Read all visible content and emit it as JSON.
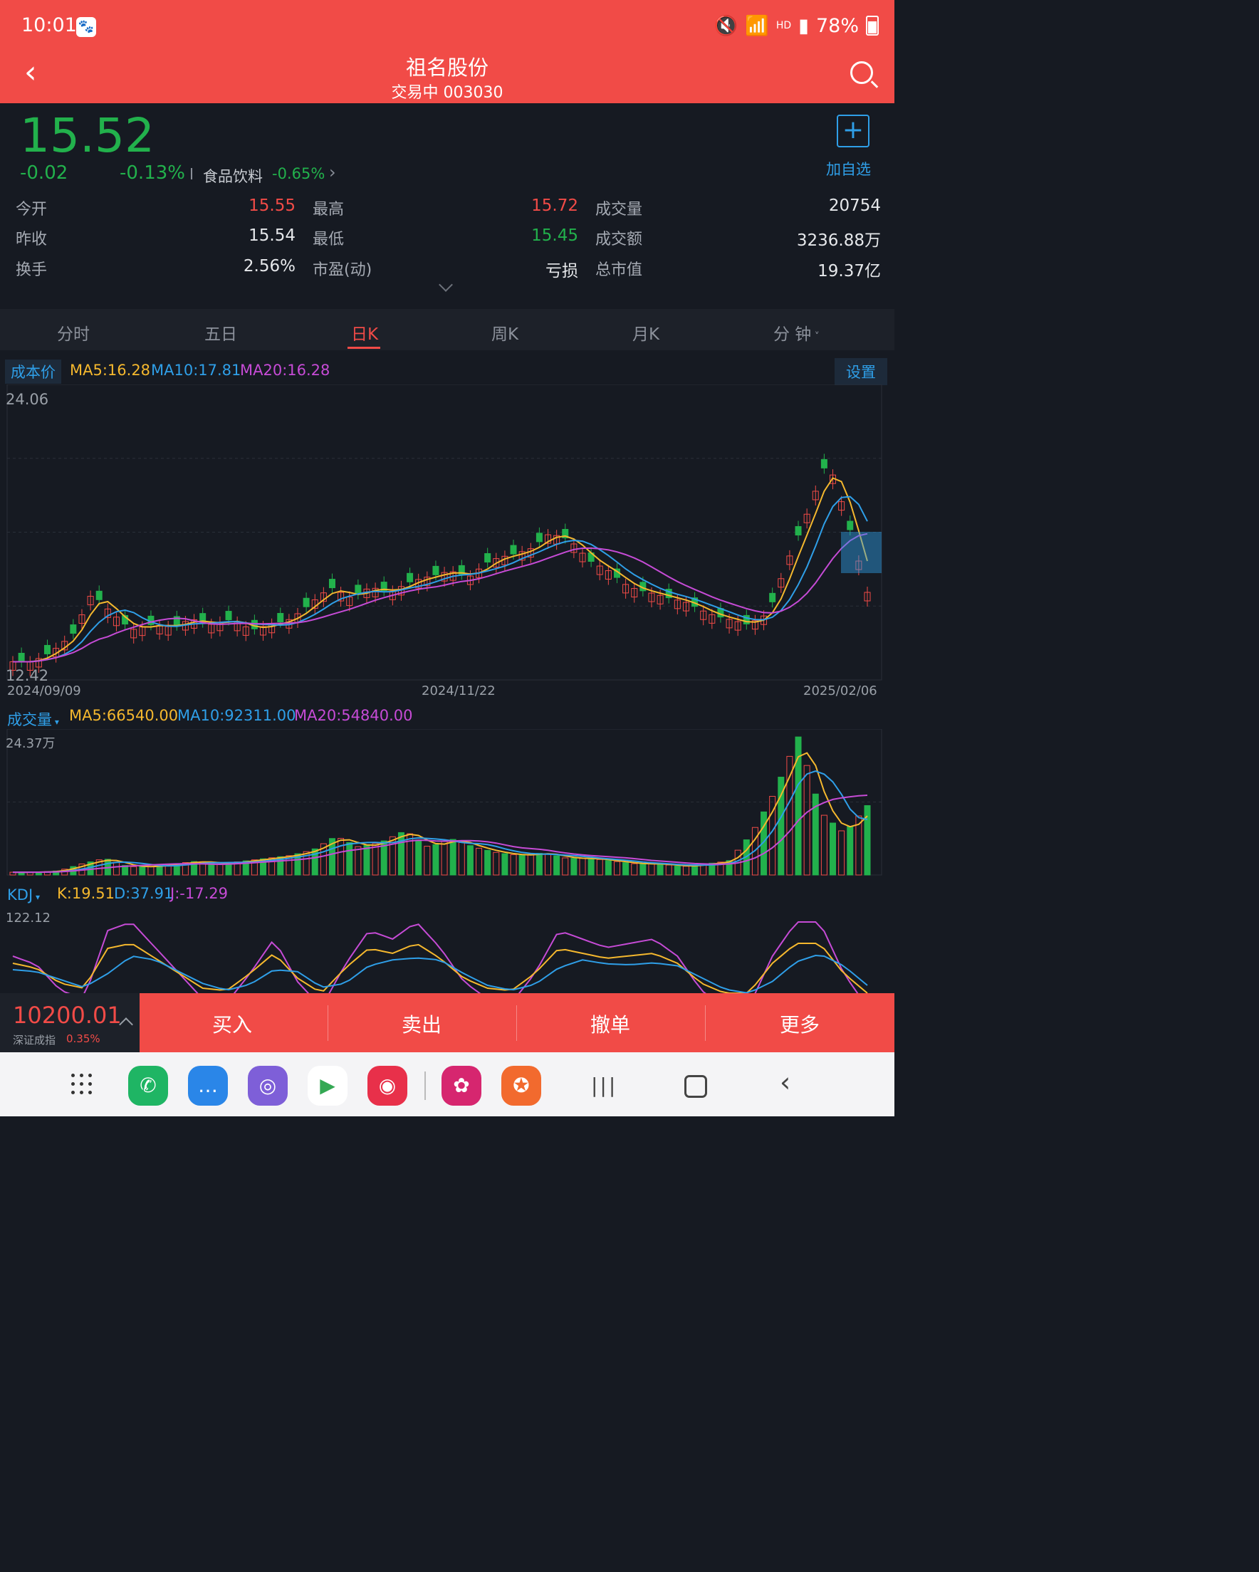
{
  "status_bar": {
    "time": "10:01",
    "network": "HD",
    "battery": "78%"
  },
  "header": {
    "title": "祖名股份",
    "subtitle": "交易中 003030"
  },
  "quote": {
    "price": "15.52",
    "change": "-0.02",
    "change_pct": "-0.13%",
    "sector_name": "食品饮料",
    "sector_change": "-0.65%",
    "watchlist_label": "加自选",
    "stats": [
      {
        "label": "今开",
        "value": "15.55",
        "color": "#f14b47"
      },
      {
        "label": "最高",
        "value": "15.72",
        "color": "#f14b47"
      },
      {
        "label": "成交量",
        "value": "20754",
        "color": "#e6e8eb"
      },
      {
        "label": "昨收",
        "value": "15.54",
        "color": "#e6e8eb"
      },
      {
        "label": "最低",
        "value": "15.45",
        "color": "#22b14c"
      },
      {
        "label": "成交额",
        "value": "3236.88万",
        "color": "#e6e8eb"
      },
      {
        "label": "换手",
        "value": "2.56%",
        "color": "#e6e8eb"
      },
      {
        "label": "市盈(动)",
        "value": "亏损",
        "color": "#e6e8eb"
      },
      {
        "label": "总市值",
        "value": "19.37亿",
        "color": "#e6e8eb"
      }
    ]
  },
  "tabs": [
    "分时",
    "五日",
    "日K",
    "周K",
    "月K",
    "分 钟"
  ],
  "active_tab": "日K",
  "kline": {
    "cost_label": "成本价",
    "ma5": "MA5:16.28",
    "ma10": "MA10:17.81",
    "ma20": "MA20:16.28",
    "settings_label": "设置",
    "y_max": "24.06",
    "y_min": "12.42",
    "dates": [
      "2024/09/09",
      "2024/11/22",
      "2025/02/06"
    ]
  },
  "volume": {
    "label": "成交量",
    "ma5": "MA5:66540.00",
    "ma10": "MA10:92311.00",
    "ma20": "MA20:54840.00",
    "y_max": "24.37万"
  },
  "kdj": {
    "label": "KDJ",
    "k": "K:19.51",
    "d": "D:37.91",
    "j": "J:-17.29",
    "y_max": "122.12"
  },
  "trade_bar": {
    "index_value": "10200.01",
    "index_name": "深证成指",
    "index_change": "0.35%",
    "buttons": [
      "买入",
      "卖出",
      "撤单",
      "更多"
    ]
  },
  "colors": {
    "up": "#f14b47",
    "down": "#22b14c",
    "ma5": "#f5b82e",
    "ma10": "#2f9fe8",
    "ma20": "#c64bd6"
  },
  "dock_apps": [
    "phone-app",
    "messages-app",
    "internet-app",
    "play-store-app",
    "camera-app",
    "flower-app",
    "stock-app"
  ]
}
